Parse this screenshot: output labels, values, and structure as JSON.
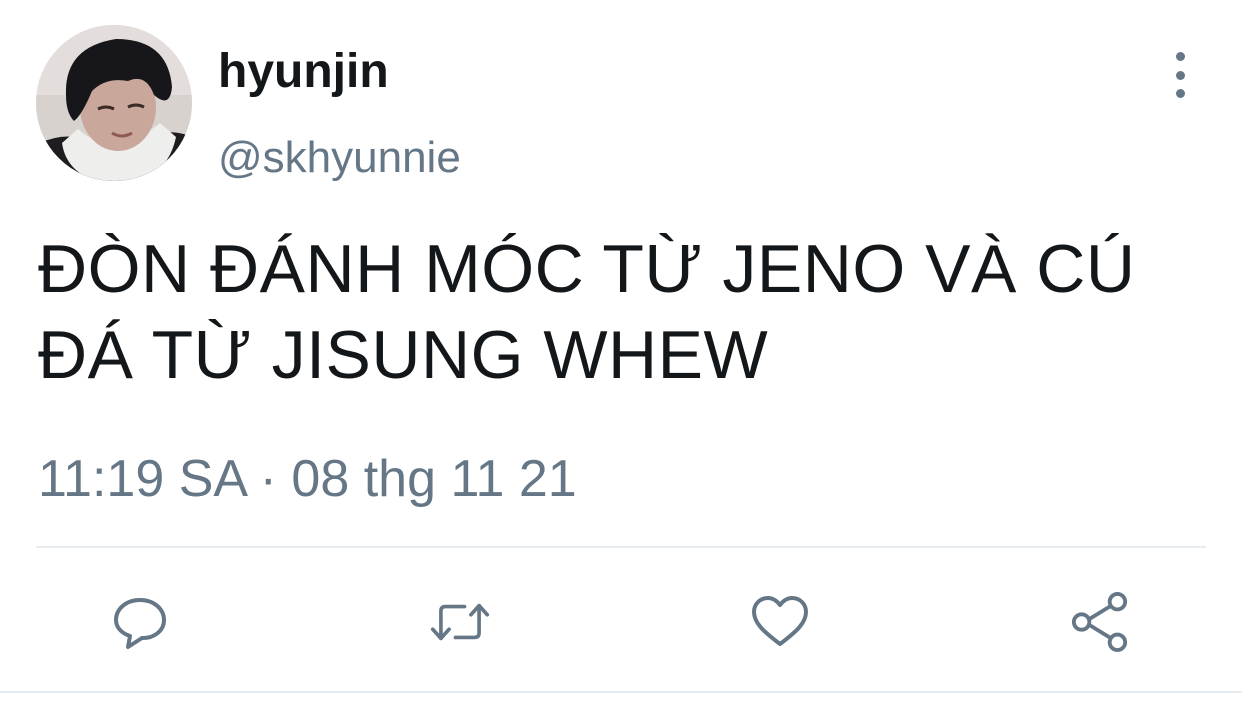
{
  "author": {
    "display_name": "hyunjin",
    "handle": "@skhyunnie"
  },
  "tweet": {
    "text": "ĐÒN ĐÁNH MÓC TỪ JENO VÀ CÚ ĐÁ TỪ JISUNG WHEW",
    "timestamp": "11:19 SA · 08 thg 11 21"
  },
  "icons": {
    "more": "more-vertical-icon",
    "reply": "reply-icon",
    "retweet": "retweet-icon",
    "like": "heart-icon",
    "share": "share-icon"
  },
  "colors": {
    "text": "#14171a",
    "secondary": "#657786",
    "divider": "#e6ecf0"
  }
}
